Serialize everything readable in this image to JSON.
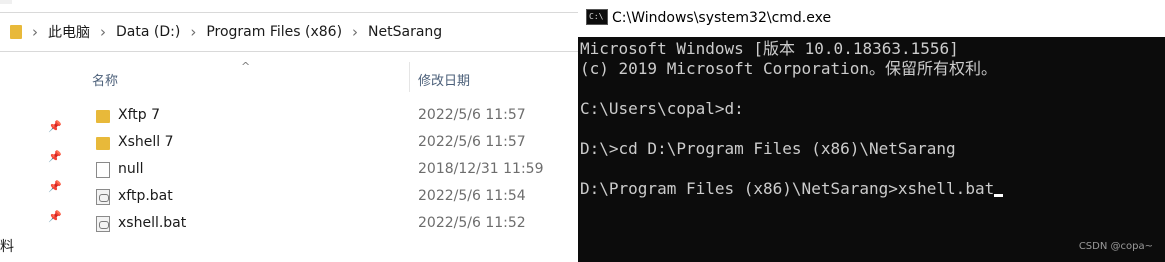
{
  "explorer": {
    "breadcrumbs": [
      "此电脑",
      "Data (D:)",
      "Program Files (x86)",
      "NetSarang"
    ],
    "columns": {
      "name": "名称",
      "modified": "修改日期"
    },
    "rows": [
      {
        "name": "Xftp 7",
        "date": "2022/5/6 11:57",
        "icon": "folder-icon"
      },
      {
        "name": "Xshell 7",
        "date": "2022/5/6 11:57",
        "icon": "folder-icon"
      },
      {
        "name": "null",
        "date": "2018/12/31 11:59",
        "icon": "file-icon"
      },
      {
        "name": "xftp.bat",
        "date": "2022/5/6 11:54",
        "icon": "batch-file-icon"
      },
      {
        "name": "xshell.bat",
        "date": "2022/5/6 11:52",
        "icon": "batch-file-icon"
      }
    ],
    "cut_off_text": "料"
  },
  "cmd": {
    "title": "C:\\Windows\\system32\\cmd.exe",
    "icon_text": "C:\\",
    "lines": [
      "Microsoft Windows [版本 10.0.18363.1556]",
      "(c) 2019 Microsoft Corporation。保留所有权利。",
      "",
      "C:\\Users\\copal>d:",
      "",
      "D:\\>cd D:\\Program Files (x86)\\NetSarang",
      "",
      "D:\\Program Files (x86)\\NetSarang>xshell.bat"
    ],
    "watermark": "CSDN @copa~"
  },
  "colors": {
    "console_bg": "#0c0c0c",
    "console_fg": "#cccccc",
    "folder": "#e8b93a"
  }
}
